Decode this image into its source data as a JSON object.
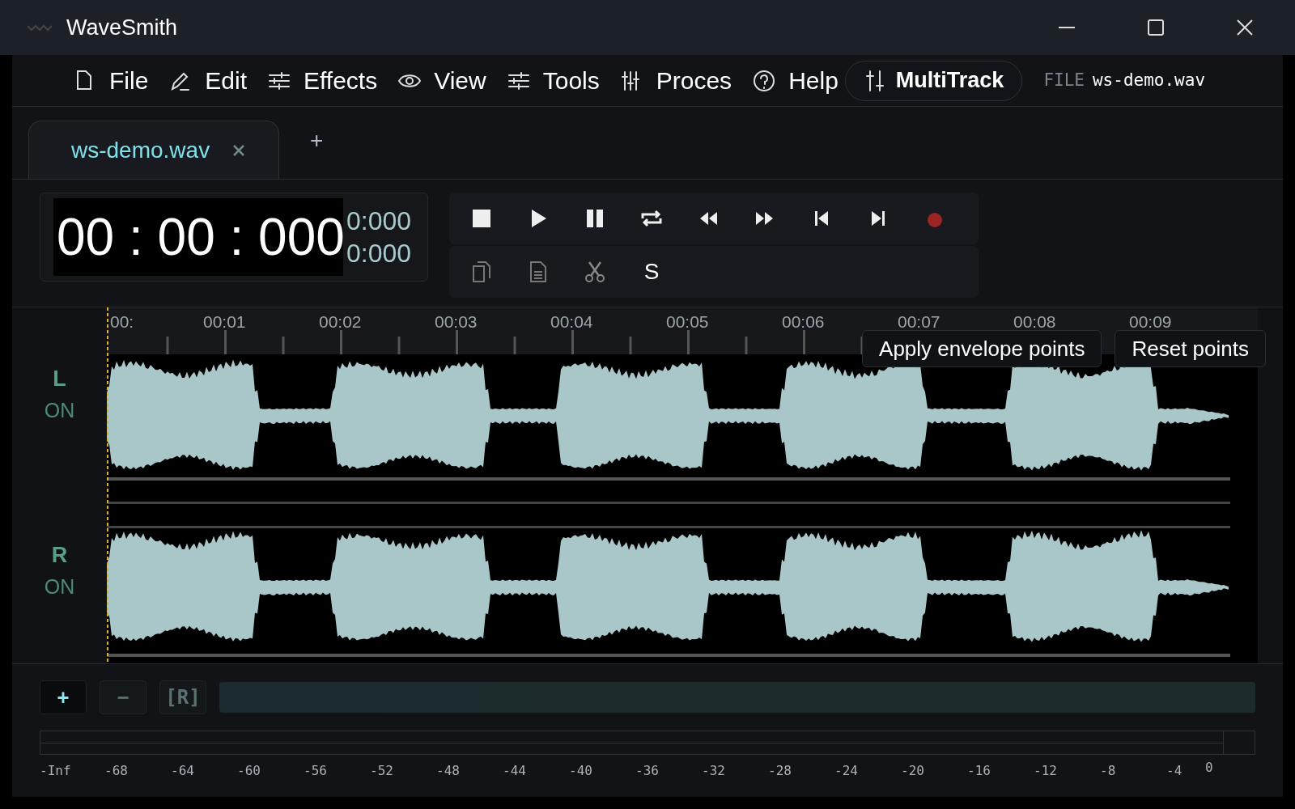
{
  "window": {
    "title": "WaveSmith"
  },
  "menu": [
    {
      "label": "File",
      "kind": "file"
    },
    {
      "label": "Edit",
      "kind": "pen"
    },
    {
      "label": "Effects",
      "kind": "sliders"
    },
    {
      "label": "View",
      "kind": "eye"
    },
    {
      "label": "Tools",
      "kind": "sliders"
    },
    {
      "label": "Proces",
      "kind": "mixer"
    },
    {
      "label": "Help",
      "kind": "help"
    }
  ],
  "multitrack_button": "MultiTrack",
  "file_info": {
    "label": "FILE",
    "name": "ws-demo.wav"
  },
  "tabs": [
    {
      "label": "ws-demo.wav",
      "selected": true
    }
  ],
  "add_tab": "+",
  "timer": {
    "main": "00 : 00 : 000",
    "readings": [
      "0:000",
      "0:000"
    ]
  },
  "transport": [
    {
      "kind": "stop"
    },
    {
      "kind": "play"
    },
    {
      "kind": "pause"
    },
    {
      "kind": "loop"
    },
    {
      "kind": "rewind"
    },
    {
      "kind": "forward"
    },
    {
      "kind": "start"
    },
    {
      "kind": "end"
    },
    {
      "kind": "record"
    }
  ],
  "edit_tools": [
    {
      "kind": "copy"
    },
    {
      "kind": "paste"
    },
    {
      "kind": "cut"
    },
    {
      "kind": "text",
      "label": "S"
    }
  ],
  "ruler": [
    "00:",
    "00:01",
    "00:02",
    "00:03",
    "00:04",
    "00:05",
    "00:06",
    "00:07",
    "00:08",
    "00:09"
  ],
  "overlay_buttons": [
    "Apply envelope points",
    "Reset points"
  ],
  "channels": [
    {
      "name": "L",
      "status": "ON"
    },
    {
      "name": "R",
      "status": "ON"
    }
  ],
  "zoom_buttons": [
    "+",
    "−",
    "[R]"
  ],
  "meter_scale": [
    "-Inf",
    "-68",
    "-64",
    "-60",
    "-56",
    "-52",
    "-48",
    "-44",
    "-40",
    "-36",
    "-32",
    "-28",
    "-24",
    "-20",
    "-16",
    "-12",
    "-8",
    "-4",
    "0"
  ]
}
